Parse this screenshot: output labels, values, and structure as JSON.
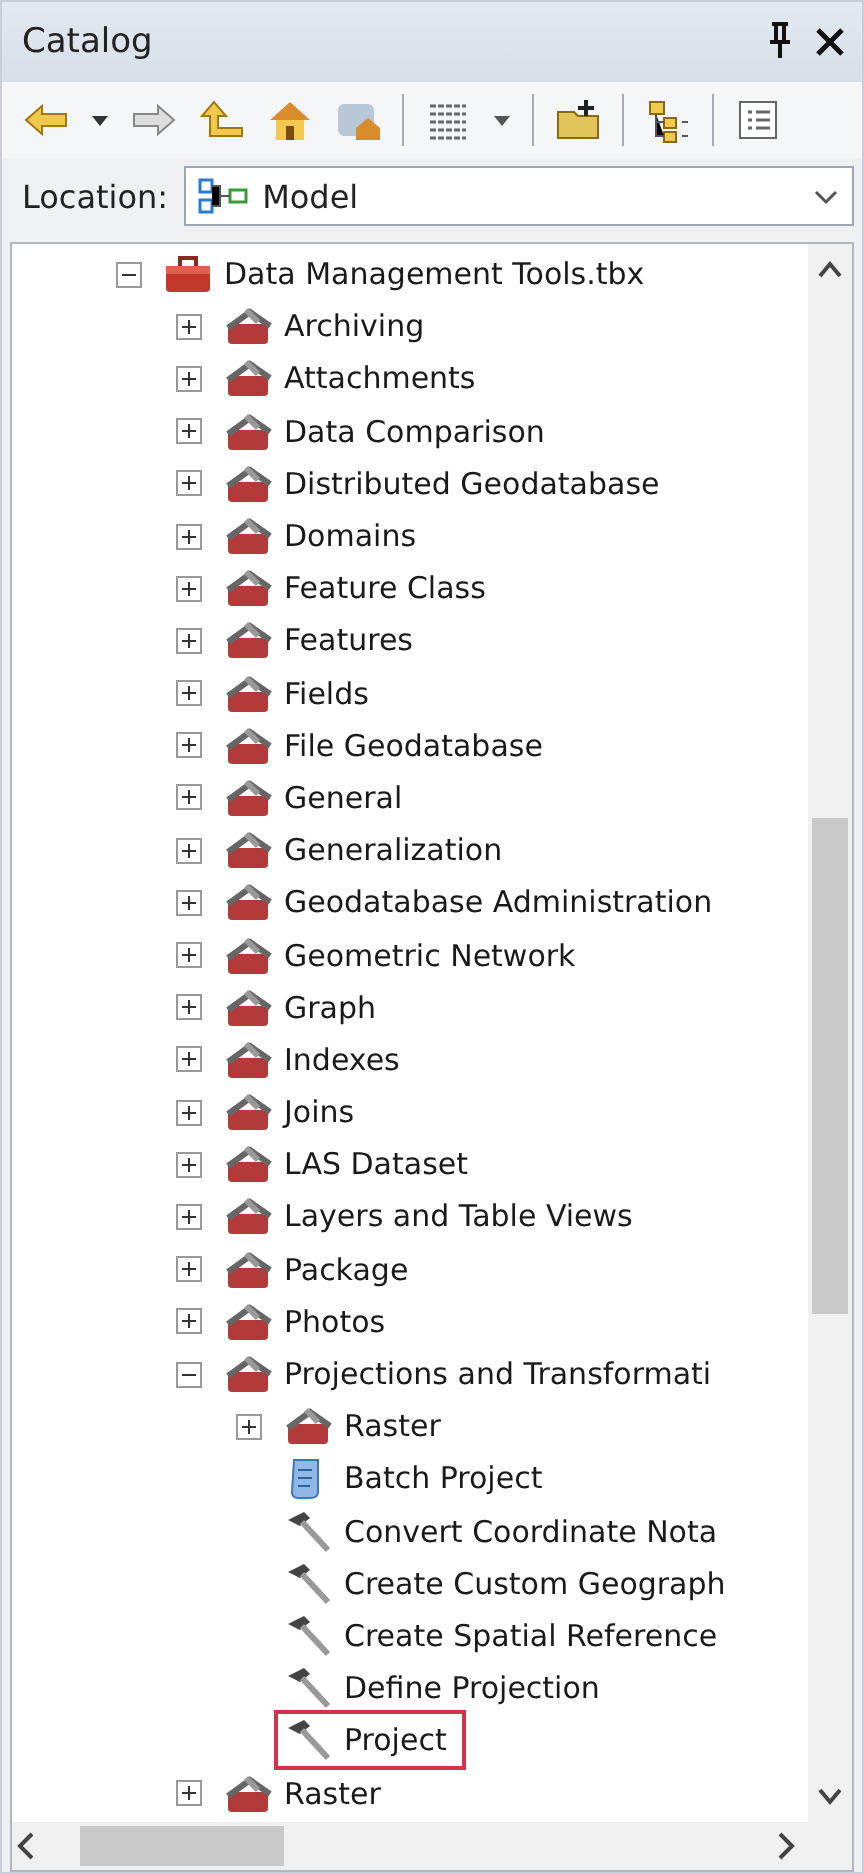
{
  "panel": {
    "title": "Catalog"
  },
  "location": {
    "label": "Location:",
    "value": "Model"
  },
  "tree": [
    {
      "label": "Data Management Tools.tbx",
      "kind": "toolbox",
      "expanded": true,
      "children": [
        {
          "label": "Archiving",
          "kind": "toolset",
          "expanded": false
        },
        {
          "label": "Attachments",
          "kind": "toolset",
          "expanded": false
        },
        {
          "label": "Data Comparison",
          "kind": "toolset",
          "expanded": false
        },
        {
          "label": "Distributed Geodatabase",
          "kind": "toolset",
          "expanded": false
        },
        {
          "label": "Domains",
          "kind": "toolset",
          "expanded": false
        },
        {
          "label": "Feature Class",
          "kind": "toolset",
          "expanded": false
        },
        {
          "label": "Features",
          "kind": "toolset",
          "expanded": false
        },
        {
          "label": "Fields",
          "kind": "toolset",
          "expanded": false
        },
        {
          "label": "File Geodatabase",
          "kind": "toolset",
          "expanded": false
        },
        {
          "label": "General",
          "kind": "toolset",
          "expanded": false
        },
        {
          "label": "Generalization",
          "kind": "toolset",
          "expanded": false
        },
        {
          "label": "Geodatabase Administration",
          "kind": "toolset",
          "expanded": false
        },
        {
          "label": "Geometric Network",
          "kind": "toolset",
          "expanded": false
        },
        {
          "label": "Graph",
          "kind": "toolset",
          "expanded": false
        },
        {
          "label": "Indexes",
          "kind": "toolset",
          "expanded": false
        },
        {
          "label": "Joins",
          "kind": "toolset",
          "expanded": false
        },
        {
          "label": "LAS Dataset",
          "kind": "toolset",
          "expanded": false
        },
        {
          "label": "Layers and Table Views",
          "kind": "toolset",
          "expanded": false
        },
        {
          "label": "Package",
          "kind": "toolset",
          "expanded": false
        },
        {
          "label": "Photos",
          "kind": "toolset",
          "expanded": false
        },
        {
          "label": "Projections and Transformati",
          "kind": "toolset",
          "expanded": true,
          "children": [
            {
              "label": "Raster",
              "kind": "toolset",
              "expanded": false,
              "highlighted": false
            },
            {
              "label": "Batch Project",
              "kind": "script",
              "highlighted": false
            },
            {
              "label": "Convert Coordinate Nota",
              "kind": "tool",
              "highlighted": false
            },
            {
              "label": "Create Custom Geograph",
              "kind": "tool",
              "highlighted": false
            },
            {
              "label": "Create Spatial Reference",
              "kind": "tool",
              "highlighted": false
            },
            {
              "label": "Define Projection",
              "kind": "tool",
              "highlighted": false
            },
            {
              "label": "Project",
              "kind": "tool",
              "highlighted": true
            }
          ]
        },
        {
          "label": "Raster",
          "kind": "toolset",
          "expanded": false
        }
      ]
    }
  ]
}
